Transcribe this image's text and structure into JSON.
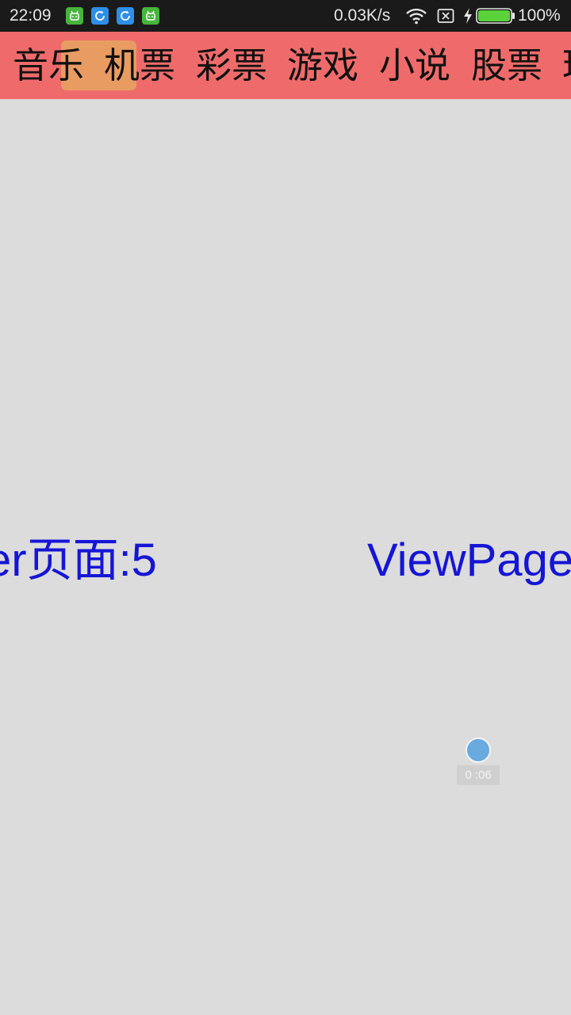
{
  "status_bar": {
    "time": "22:09",
    "network_speed": "0.03K/s",
    "battery_percent": "100%",
    "battery_level": 1.0,
    "notification_icons": [
      "android-icon",
      "sync-icon",
      "sync-icon",
      "android-icon"
    ]
  },
  "tabs": {
    "items": [
      {
        "label": "音乐"
      },
      {
        "label": "机票"
      },
      {
        "label": "彩票"
      },
      {
        "label": "游戏"
      },
      {
        "label": "小说"
      },
      {
        "label": "股票"
      }
    ],
    "clipped_next": "理",
    "highlight_color": "#e89c62",
    "strip_color": "#ef6b6b"
  },
  "pager": {
    "left_page_text": "er页面:5",
    "right_page_text": "ViewPage",
    "text_color": "#1515d6"
  },
  "floating_widget": {
    "time": "0 :06"
  }
}
